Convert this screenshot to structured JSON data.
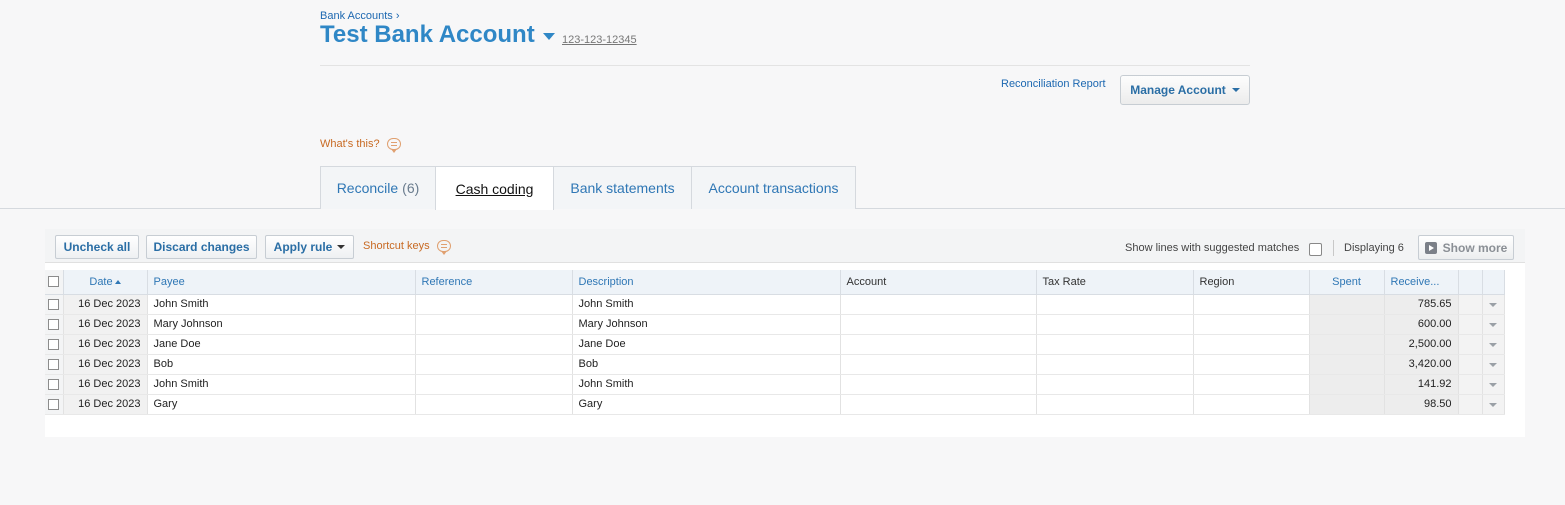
{
  "header": {
    "breadcrumb": "Bank Accounts ›",
    "title": "Test Bank Account",
    "account_number": "123-123-12345",
    "reconciliation_report": "Reconciliation Report",
    "manage_account": "Manage Account"
  },
  "help": {
    "whats_this": "What's this?"
  },
  "tabs": [
    {
      "label": "Reconcile",
      "count": "(6)"
    },
    {
      "label": "Cash coding"
    },
    {
      "label": "Bank statements"
    },
    {
      "label": "Account transactions"
    }
  ],
  "toolbar": {
    "uncheck_all": "Uncheck all",
    "discard_changes": "Discard changes",
    "apply_rule": "Apply rule",
    "shortcut_keys": "Shortcut keys",
    "show_lines": "Show lines with suggested matches",
    "displaying": "Displaying 6",
    "show_more": "Show more"
  },
  "columns": {
    "date": "Date",
    "payee": "Payee",
    "reference": "Reference",
    "description": "Description",
    "account": "Account",
    "tax_rate": "Tax Rate",
    "region": "Region",
    "spent": "Spent",
    "received": "Receive..."
  },
  "rows": [
    {
      "date": "16 Dec 2023",
      "payee": "John Smith",
      "reference": "",
      "description": "John Smith",
      "account": "",
      "tax_rate": "",
      "region": "",
      "spent": "",
      "received": "785.65"
    },
    {
      "date": "16 Dec 2023",
      "payee": "Mary Johnson",
      "reference": "",
      "description": "Mary Johnson",
      "account": "",
      "tax_rate": "",
      "region": "",
      "spent": "",
      "received": "600.00"
    },
    {
      "date": "16 Dec 2023",
      "payee": "Jane Doe",
      "reference": "",
      "description": "Jane Doe",
      "account": "",
      "tax_rate": "",
      "region": "",
      "spent": "",
      "received": "2,500.00"
    },
    {
      "date": "16 Dec 2023",
      "payee": "Bob",
      "reference": "",
      "description": "Bob",
      "account": "",
      "tax_rate": "",
      "region": "",
      "spent": "",
      "received": "3,420.00"
    },
    {
      "date": "16 Dec 2023",
      "payee": "John Smith",
      "reference": "",
      "description": "John Smith",
      "account": "",
      "tax_rate": "",
      "region": "",
      "spent": "",
      "received": "141.92"
    },
    {
      "date": "16 Dec 2023",
      "payee": "Gary",
      "reference": "",
      "description": "Gary",
      "account": "",
      "tax_rate": "",
      "region": "",
      "spent": "",
      "received": "98.50"
    }
  ],
  "colors": {
    "title": "#2f87c6",
    "link": "#1d68b1",
    "help": "#c86a23"
  }
}
